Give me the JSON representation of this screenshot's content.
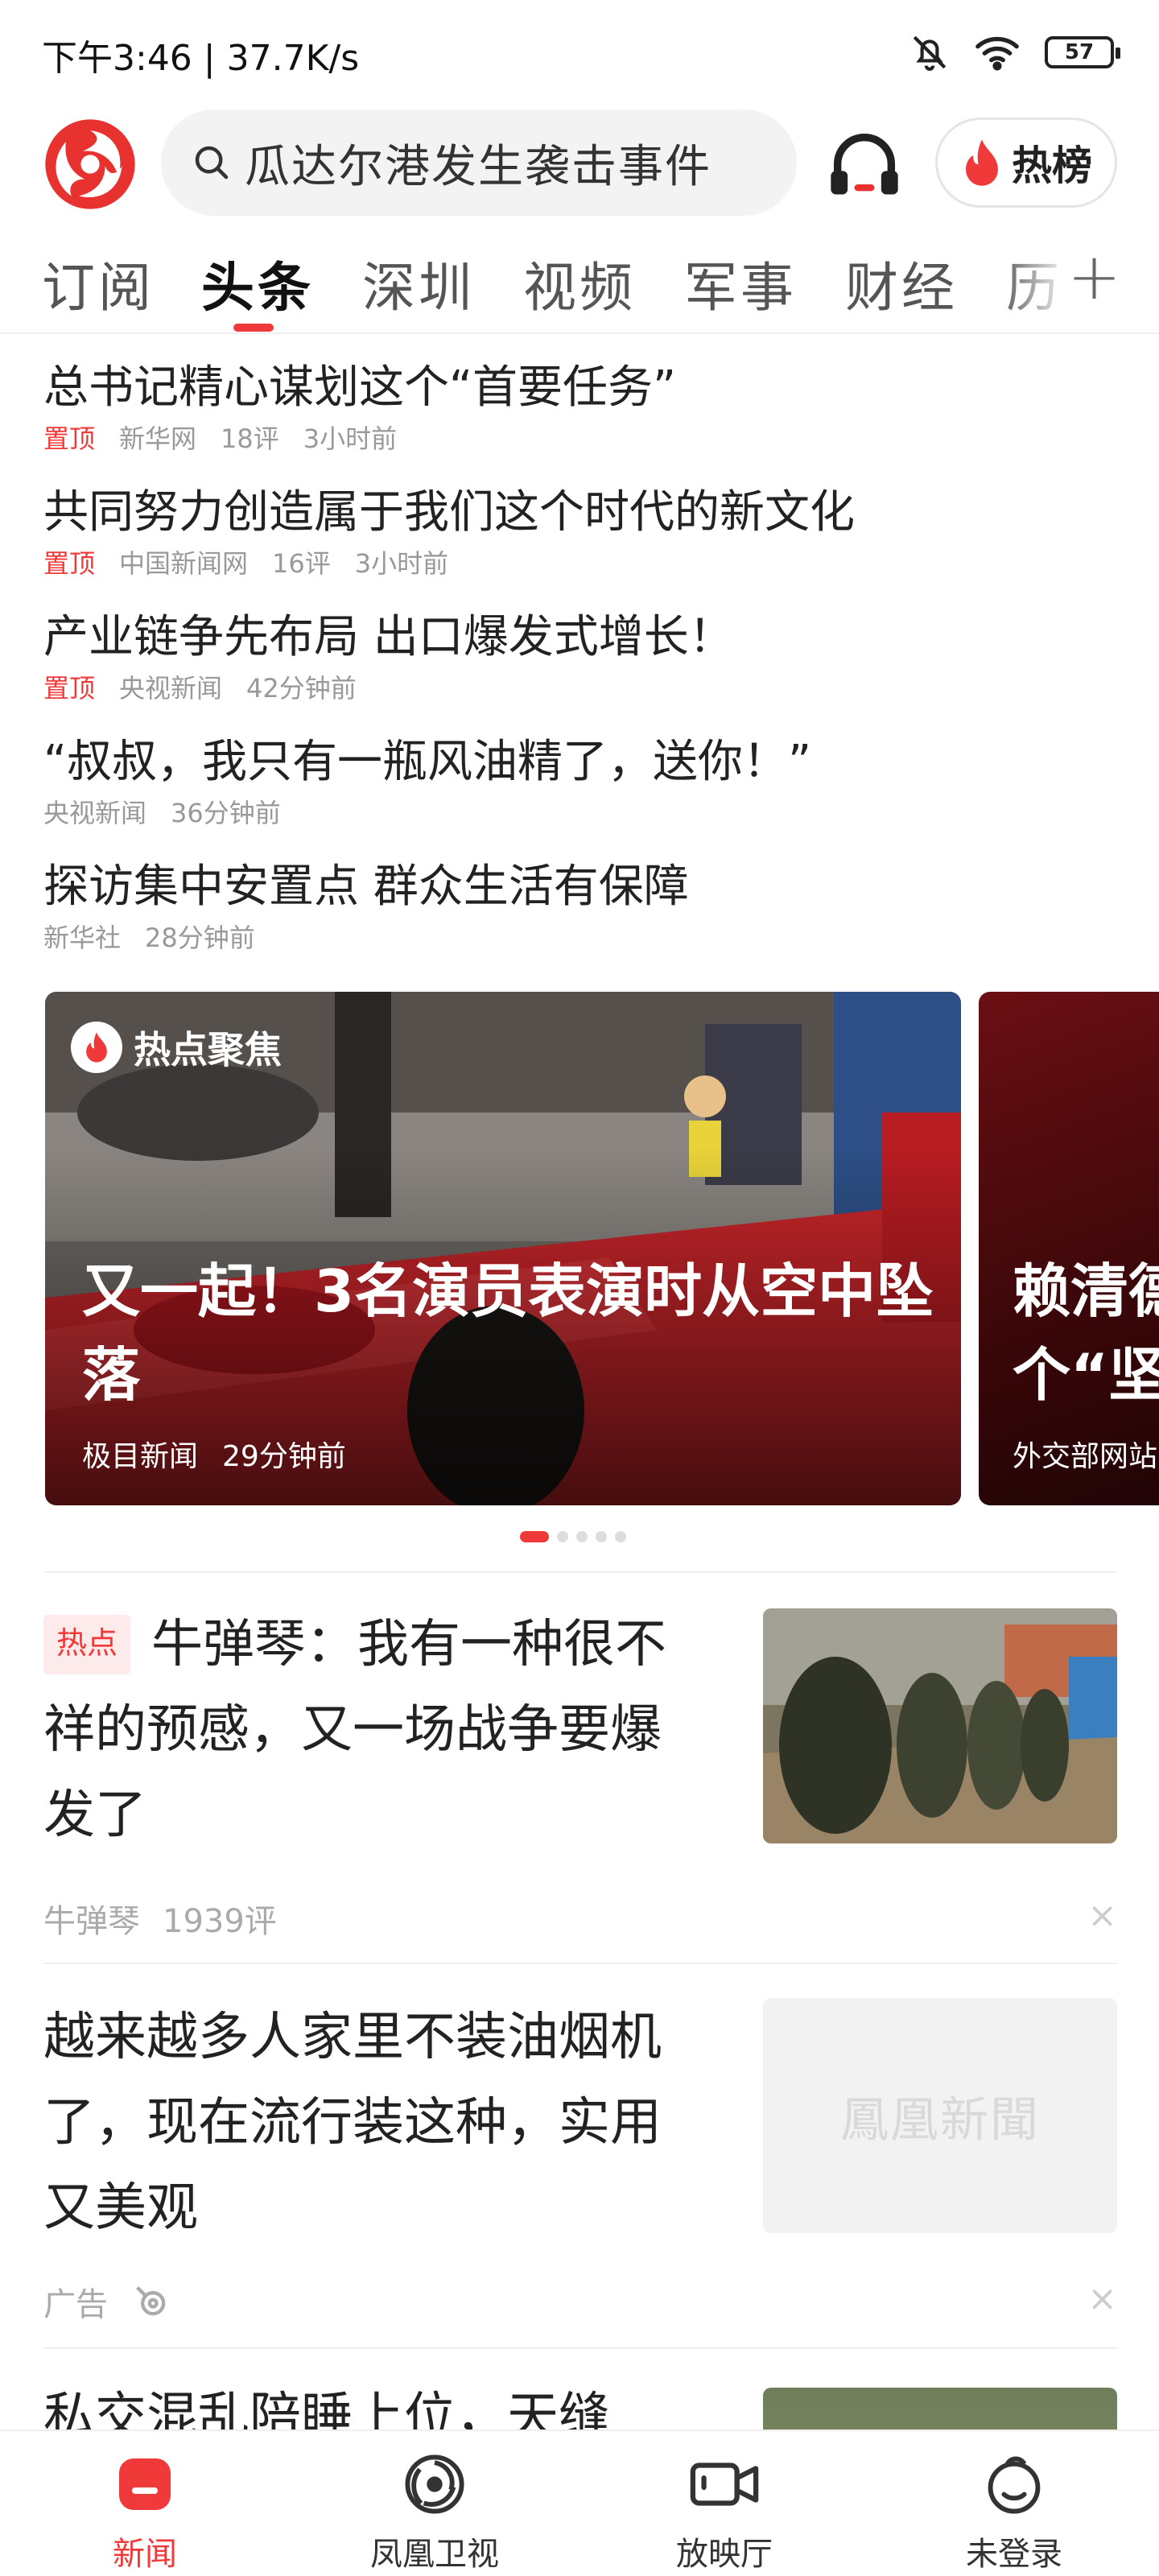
{
  "status_bar": {
    "time_speed": "下午3:46 | 37.7K/s",
    "battery": "57"
  },
  "header": {
    "search_placeholder": "瓜达尔港发生袭击事件",
    "hot_label": "热榜"
  },
  "tabs": [
    {
      "label": "订阅"
    },
    {
      "label": "头条"
    },
    {
      "label": "深圳"
    },
    {
      "label": "视频"
    },
    {
      "label": "军事"
    },
    {
      "label": "财经"
    },
    {
      "label": "历"
    }
  ],
  "pinned_news": [
    {
      "title": "总书记精心谋划这个“首要任务”",
      "tag": "置顶",
      "source": "新华网",
      "comments": "18评",
      "time": "3小时前"
    },
    {
      "title": "共同努力创造属于我们这个时代的新文化",
      "tag": "置顶",
      "source": "中国新闻网",
      "comments": "16评",
      "time": "3小时前"
    },
    {
      "title": "产业链争先布局 出口爆发式增长！",
      "tag": "置顶",
      "source": "央视新闻",
      "time": "42分钟前"
    },
    {
      "title": "“叔叔，我只有一瓶风油精了，送你！”",
      "source": "央视新闻",
      "time": "36分钟前"
    },
    {
      "title": "探访集中安置点 群众生活有保障",
      "source": "新华社",
      "time": "28分钟前"
    }
  ],
  "carousel": {
    "badge": "热点聚焦",
    "main": {
      "title": "又一起！3名演员表演时从空中坠落",
      "source": "极目新闻",
      "time": "29分钟前"
    },
    "peek": {
      "title_line1": "赖清德",
      "title_line2": "个“坚",
      "source": "外交部网站"
    },
    "active_index": 0
  },
  "feed": [
    {
      "tag": "热点",
      "title": "牛弹琴：我有一种很不祥的预感，又一场战争要爆发了",
      "source": "牛弹琴",
      "comments": "1939评"
    },
    {
      "title": "越来越多人家里不装油烟机了，现在流行装这种，实用又美观",
      "ad_label": "广告",
      "thumb_text": "鳳凰新聞"
    },
    {
      "title": "私交混乱陪睡上位，天缝"
    }
  ],
  "bottom_nav": [
    {
      "label": "新闻",
      "active": true
    },
    {
      "label": "凤凰卫视"
    },
    {
      "label": "放映厅"
    },
    {
      "label": "未登录"
    }
  ],
  "colors": {
    "accent": "#f03a3a",
    "text": "#222222",
    "muted": "#999999"
  }
}
